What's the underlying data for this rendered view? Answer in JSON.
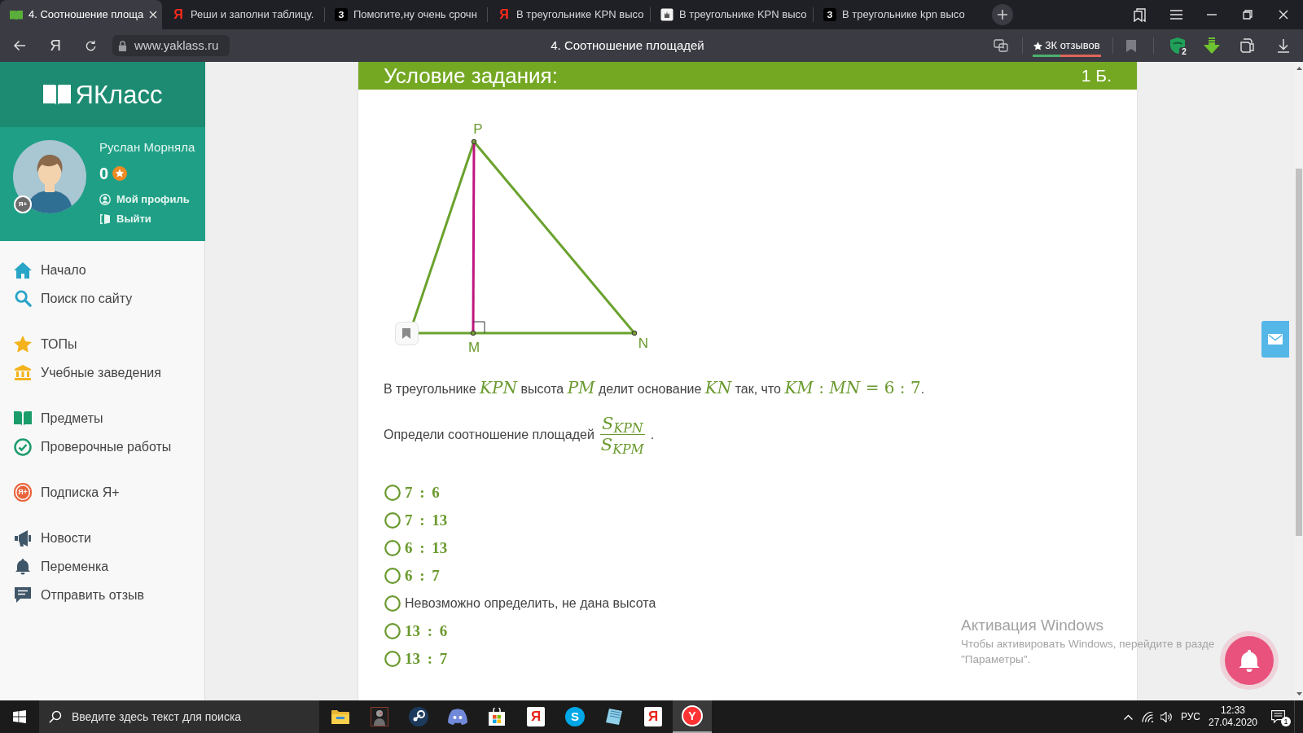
{
  "browser": {
    "tabs": [
      {
        "title": "4. Соотношение площа",
        "kind": "book",
        "selected": true
      },
      {
        "title": "Реши и заполни таблицу.",
        "kind": "letter",
        "glyph": "Я",
        "selected": false
      },
      {
        "title": "Помогите,ну очень срочн",
        "kind": "tile",
        "glyph": "З",
        "selected": false
      },
      {
        "title": "В треугольнике KPN высо",
        "kind": "letter",
        "glyph": "Я",
        "selected": false
      },
      {
        "title": "В треугольнике KPN высо",
        "kind": "page",
        "selected": false
      },
      {
        "title": "В треугольнике kpn высо",
        "kind": "tile",
        "glyph": "З",
        "selected": false
      }
    ],
    "address_bar": {
      "home_glyph": "Я",
      "url": "www.yaklass.ru",
      "page_title": "4. Соотношение площадей",
      "reviews": "3К отзывов",
      "shield_count": "2"
    }
  },
  "sidebar": {
    "logo": "ЯКласс",
    "user": {
      "name": "Руслан Морняла",
      "badge": "Я+",
      "score": "0",
      "links": [
        {
          "label": "Мой профиль",
          "kind": "profile"
        },
        {
          "label": "Выйти",
          "kind": "exit"
        }
      ]
    },
    "menu": [
      {
        "items": [
          {
            "label": "Начало",
            "kind": "home"
          },
          {
            "label": "Поиск по сайту",
            "kind": "search"
          }
        ]
      },
      {
        "items": [
          {
            "label": "ТОПы",
            "kind": "star"
          },
          {
            "label": "Учебные заведения",
            "kind": "building"
          }
        ]
      },
      {
        "items": [
          {
            "label": "Предметы",
            "kind": "book"
          },
          {
            "label": "Проверочные работы",
            "kind": "check"
          }
        ]
      },
      {
        "items": [
          {
            "label": "Подписка Я+",
            "kind": "badge",
            "badge": "Я+"
          }
        ]
      },
      {
        "items": [
          {
            "label": "Новости",
            "kind": "megaphone"
          },
          {
            "label": "Переменка",
            "kind": "bell"
          },
          {
            "label": "Отправить отзыв",
            "kind": "chat"
          }
        ]
      }
    ]
  },
  "task": {
    "title": "Условие задания:",
    "points": "1 Б.",
    "diagram": {
      "vertex_labels": [
        "P",
        "M",
        "N"
      ]
    },
    "statement": [
      {
        "kind": "text",
        "text": "В треугольнике "
      },
      {
        "kind": "var",
        "text": "KPN"
      },
      {
        "kind": "text",
        "text": " высота "
      },
      {
        "kind": "var",
        "text": "PM"
      },
      {
        "kind": "text",
        "text": " делит основание "
      },
      {
        "kind": "var",
        "text": "KN"
      },
      {
        "kind": "text",
        "text": " так, что "
      },
      {
        "kind": "expr",
        "text": "*KM* : *MN* = 6 : 7"
      },
      {
        "kind": "text",
        "text": "."
      }
    ],
    "question": {
      "text": "Определи соотношение площадей",
      "numerator": "S$_{KPN}$",
      "denominator": "S$_{KPM}$",
      "end": "."
    },
    "options": [
      {
        "kind": "math",
        "text": "7 : 6",
        "selected": false
      },
      {
        "kind": "math",
        "text": "7 : 13",
        "selected": false
      },
      {
        "kind": "math",
        "text": "6 : 13",
        "selected": false
      },
      {
        "kind": "math",
        "text": "6 : 7",
        "selected": false
      },
      {
        "kind": "text",
        "text": "Невозможно определить, не дана высота",
        "selected": false
      },
      {
        "kind": "math",
        "text": "13 : 6",
        "selected": false
      },
      {
        "kind": "math",
        "text": "13 : 7",
        "selected": false
      }
    ]
  },
  "windows_activation": {
    "title": "Активация Windows",
    "lines": [
      "Чтобы активировать Windows, перейдите в разде",
      "\"Параметры\"."
    ]
  },
  "taskbar": {
    "search": {
      "placeholder": "Введите здесь текст для поиска"
    },
    "apps": [
      {
        "kind": "folder",
        "selected": false
      },
      {
        "kind": "figure",
        "selected": false
      },
      {
        "kind": "disc",
        "selected": false
      },
      {
        "kind": "controller",
        "selected": false
      },
      {
        "kind": "bag",
        "selected": false
      },
      {
        "kind": "tile",
        "glyph": "Я",
        "selected": false
      },
      {
        "kind": "round",
        "glyph": "S",
        "selected": false
      },
      {
        "kind": "sheet",
        "selected": false
      },
      {
        "kind": "tile",
        "glyph": "Я",
        "selected": false
      },
      {
        "kind": "badge",
        "glyph": "Y",
        "selected": true
      }
    ]
  },
  "tray": {
    "language": "РУС",
    "time": "12:33",
    "date": "27.04.2020",
    "notifications": "1"
  }
}
